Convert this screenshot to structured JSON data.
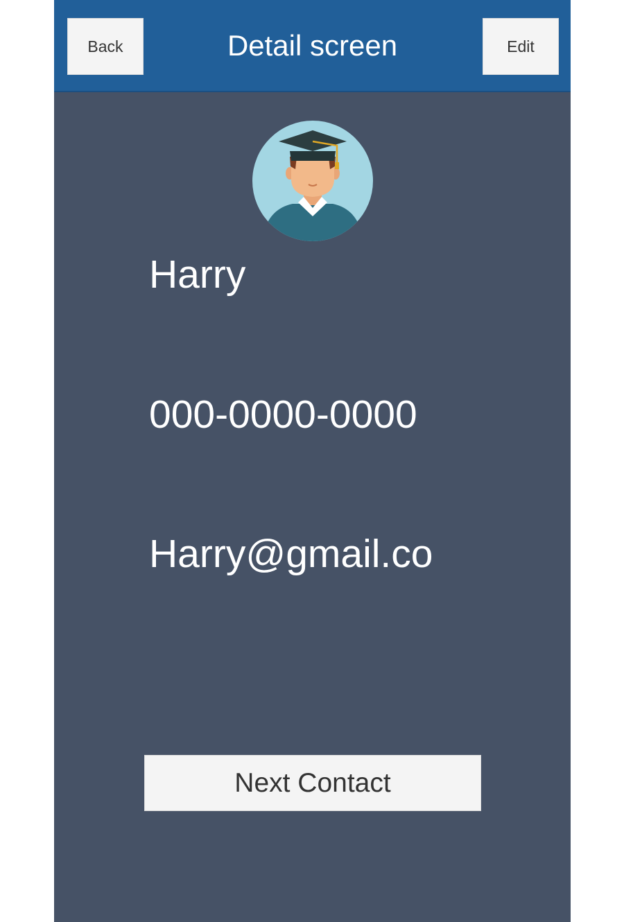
{
  "header": {
    "title": "Detail screen",
    "back_label": "Back",
    "edit_label": "Edit",
    "bg_color": "#215f99"
  },
  "contact": {
    "avatar_icon": "graduate-avatar-icon",
    "name": "Harry",
    "phone": "000-0000-0000",
    "email": "Harry@gmail.co"
  },
  "footer": {
    "next_label": "Next Contact"
  },
  "colors": {
    "background": "#465266",
    "button": "#f4f4f4",
    "text": "#ffffff"
  }
}
